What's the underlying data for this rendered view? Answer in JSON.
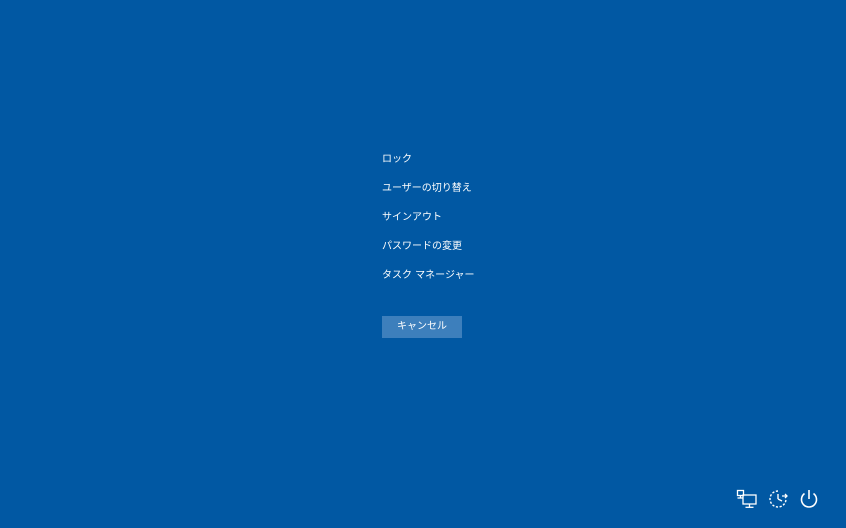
{
  "menu": {
    "items": [
      {
        "label": "ロック"
      },
      {
        "label": "ユーザーの切り替え"
      },
      {
        "label": "サインアウト"
      },
      {
        "label": "パスワードの変更"
      },
      {
        "label": "タスク マネージャー"
      }
    ]
  },
  "cancel": {
    "label": "キャンセル"
  },
  "tray": {
    "icons": [
      "network-icon",
      "accessibility-icon",
      "power-icon"
    ]
  },
  "colors": {
    "background": "#0158a3",
    "button": "#3d7fbc",
    "text": "#ffffff"
  }
}
